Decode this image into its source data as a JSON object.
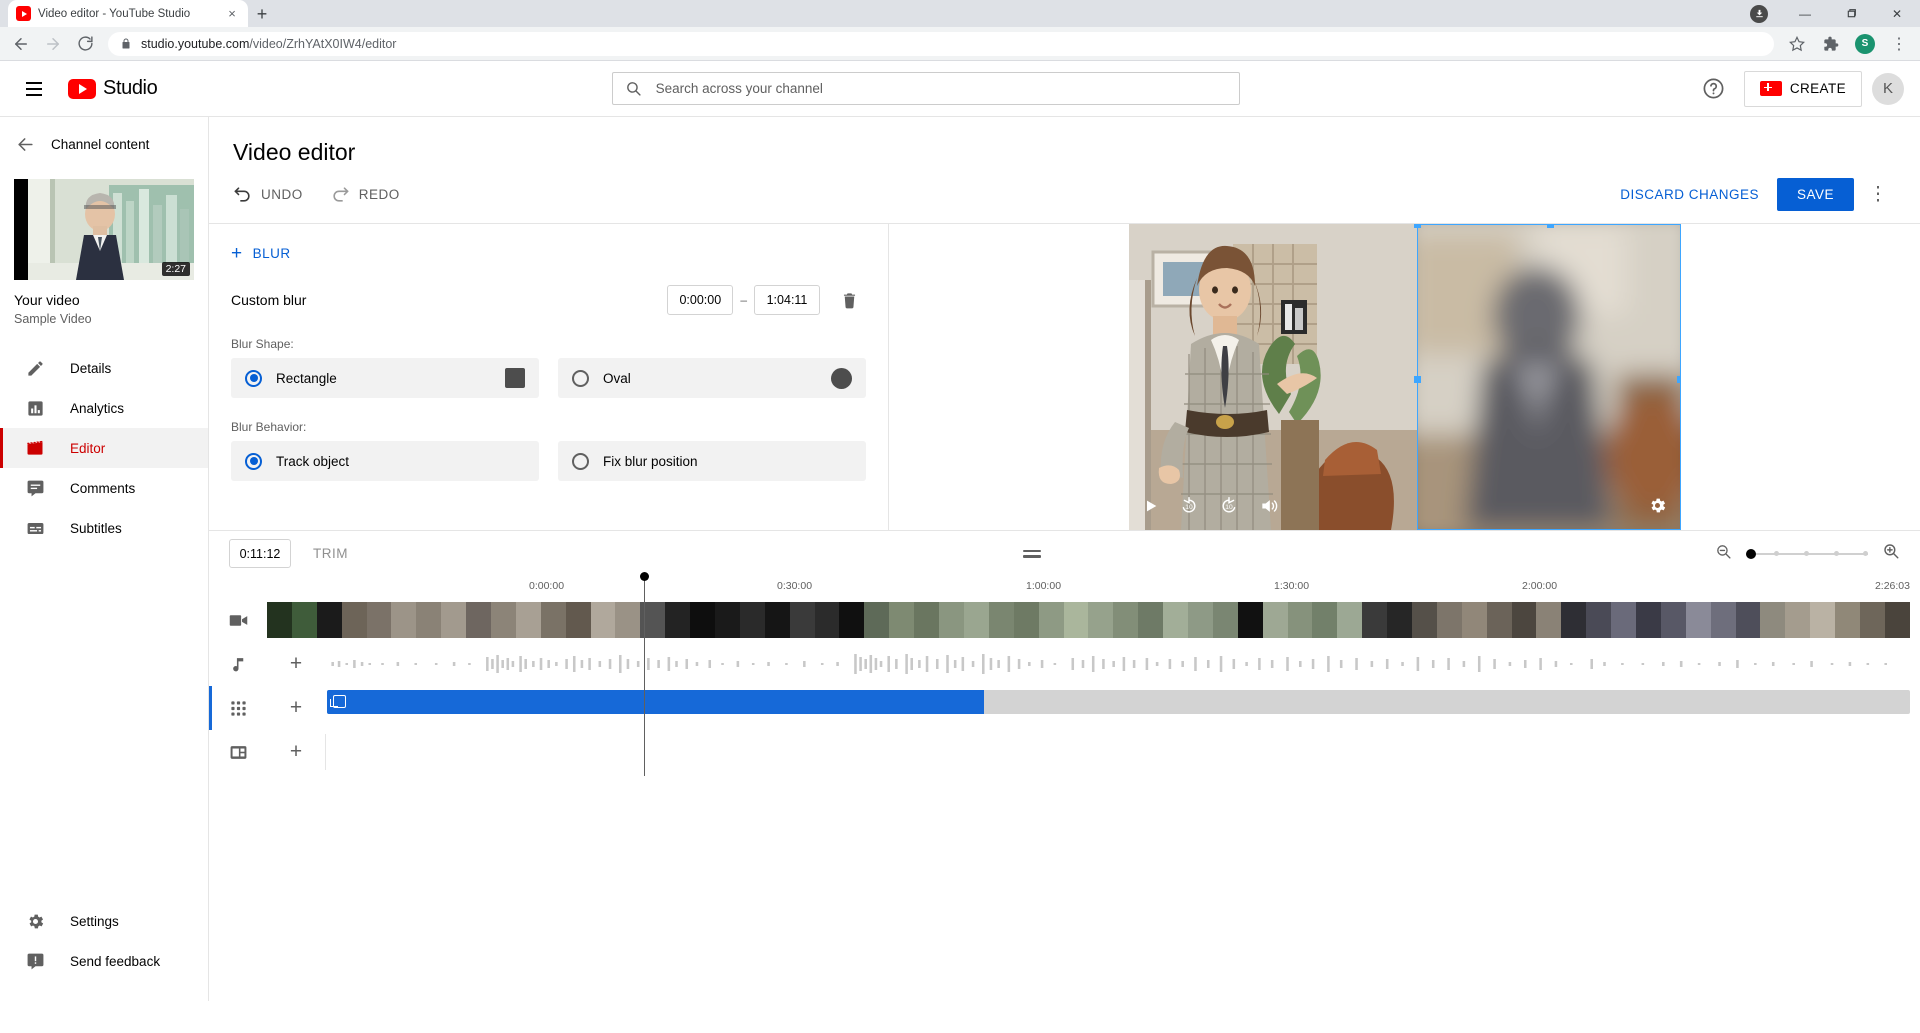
{
  "browser": {
    "tab_title": "Video editor - YouTube Studio",
    "tab_close_glyph": "×",
    "new_tab_glyph": "+",
    "url_host": "studio.youtube.com",
    "url_path": "/video/ZrhYAtX0IW4/editor",
    "minimize_glyph": "—",
    "maximize_glyph": "❐",
    "close_glyph": "✕",
    "profile_initial": "S",
    "menu_glyph": "⋮"
  },
  "header": {
    "brand": "Studio",
    "search_placeholder": "Search across your channel",
    "create_label": "CREATE",
    "account_initial": "K"
  },
  "sidebar": {
    "back_label": "Channel content",
    "video_duration": "2:27",
    "video_title": "Your video",
    "video_subtitle": "Sample Video",
    "items": [
      {
        "label": "Details",
        "icon": "pencil-icon",
        "active": false
      },
      {
        "label": "Analytics",
        "icon": "analytics-icon",
        "active": false
      },
      {
        "label": "Editor",
        "icon": "clapperboard-icon",
        "active": true
      },
      {
        "label": "Comments",
        "icon": "comments-icon",
        "active": false
      },
      {
        "label": "Subtitles",
        "icon": "subtitles-icon",
        "active": false
      }
    ],
    "bottom_items": [
      {
        "label": "Settings",
        "icon": "gear-icon"
      },
      {
        "label": "Send feedback",
        "icon": "feedback-icon"
      }
    ]
  },
  "page": {
    "title": "Video editor",
    "undo_label": "UNDO",
    "redo_label": "REDO",
    "discard_label": "DISCARD CHANGES",
    "save_label": "SAVE",
    "more_glyph": "⋮"
  },
  "blur_panel": {
    "add_blur_label": "BLUR",
    "add_glyph": "+",
    "blur_name": "Custom blur",
    "start_time": "0:00:00",
    "end_time": "1:04:11",
    "range_dash": "–",
    "shape_label": "Blur Shape:",
    "shape_options": [
      {
        "label": "Rectangle",
        "selected": true,
        "preview": "square"
      },
      {
        "label": "Oval",
        "selected": false,
        "preview": "circle"
      }
    ],
    "behavior_label": "Blur Behavior:",
    "behavior_options": [
      {
        "label": "Track object",
        "selected": true
      },
      {
        "label": "Fix blur position",
        "selected": false
      }
    ]
  },
  "player": {
    "play_glyph": "▶",
    "rewind_label": "10",
    "forward_label": "10",
    "volume_icon": "volume-icon",
    "settings_icon": "gear-icon"
  },
  "timeline": {
    "current_time": "0:11:12",
    "trim_label": "TRIM",
    "zoom_out_icon": "zoom-out-icon",
    "zoom_in_icon": "zoom-in-icon",
    "ruler_labels": [
      "0:00:00",
      "0:30:00",
      "1:00:00",
      "1:30:00",
      "2:00:00"
    ],
    "ruler_end_label": "2:26:03",
    "tracks": [
      {
        "name": "video-track",
        "icon": "video-camera-icon",
        "addable": false
      },
      {
        "name": "audio-track",
        "icon": "music-note-icon",
        "addable": true
      },
      {
        "name": "blur-track",
        "icon": "blur-grid-icon",
        "addable": true
      },
      {
        "name": "endscreen-track",
        "icon": "endscreen-icon",
        "addable": true
      }
    ]
  },
  "colors": {
    "brand_red": "#ff0000",
    "accent_blue": "#065fd4",
    "clip_blue": "#1669d8",
    "active_red": "#cc0000",
    "selection_blue": "#3ea6ff"
  }
}
